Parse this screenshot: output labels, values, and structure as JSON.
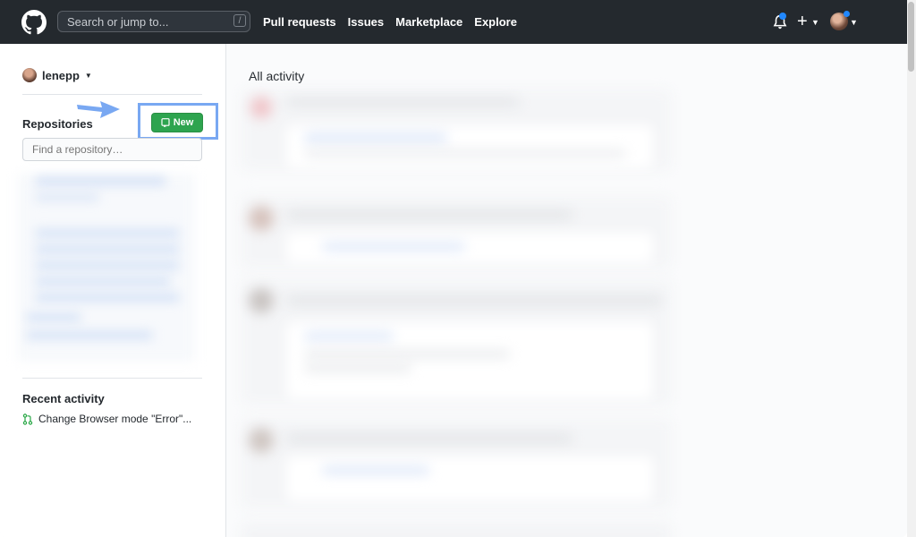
{
  "header": {
    "search_placeholder": "Search or jump to...",
    "search_shortcut": "/",
    "nav": [
      "Pull requests",
      "Issues",
      "Marketplace",
      "Explore"
    ],
    "plus": "+"
  },
  "sidebar": {
    "username": "lenepp",
    "repositories_title": "Repositories",
    "new_button_label": "New",
    "find_placeholder": "Find a repository…",
    "recent_activity_title": "Recent activity",
    "recent_item": "Change Browser mode \"Error\"..."
  },
  "main": {
    "title": "All activity"
  },
  "colors": {
    "header_bg": "#24292e",
    "new_button": "#2ea44f",
    "highlight": "#79a8f2",
    "arrow": "#79a8f2"
  }
}
